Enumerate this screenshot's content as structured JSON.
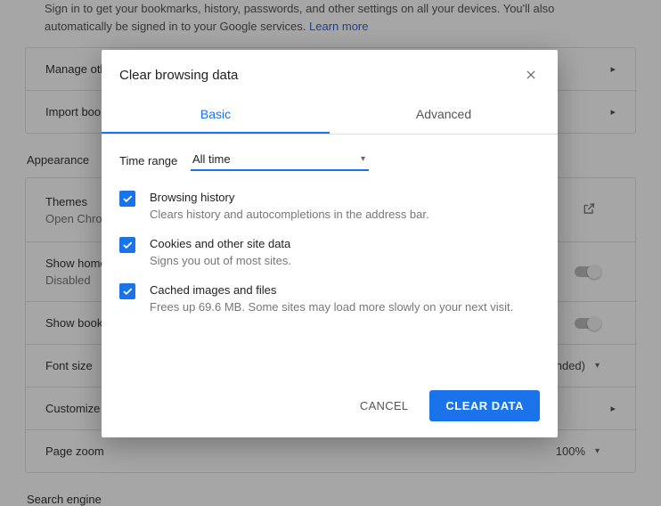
{
  "bg": {
    "intro": "Sign in to get your bookmarks, history, passwords, and other settings on all your devices. You'll also automatically be signed in to your Google services.",
    "learn_more": "Learn more",
    "rows": {
      "manage": "Manage other people",
      "import": "Import bookmarks and settings"
    },
    "appearance": "Appearance",
    "themes_title": "Themes",
    "themes_sub": "Open Chrome Web Store",
    "show_home_title": "Show home button",
    "show_home_sub": "Disabled",
    "show_book": "Show bookmarks bar",
    "font_size": "Font size",
    "font_value": "Medium (Recommended)",
    "customize": "Customize fonts",
    "zoom": "Page zoom",
    "zoom_value": "100%",
    "search_engine": "Search engine"
  },
  "dialog": {
    "title": "Clear browsing data",
    "tabs": {
      "basic": "Basic",
      "advanced": "Advanced"
    },
    "time_label": "Time range",
    "time_value": "All time",
    "opts": {
      "history_t": "Browsing history",
      "history_d": "Clears history and autocompletions in the address bar.",
      "cookies_t": "Cookies and other site data",
      "cookies_d": "Signs you out of most sites.",
      "cache_t": "Cached images and files",
      "cache_d": "Frees up 69.6 MB. Some sites may load more slowly on your next visit."
    },
    "cancel": "CANCEL",
    "clear": "CLEAR DATA"
  }
}
